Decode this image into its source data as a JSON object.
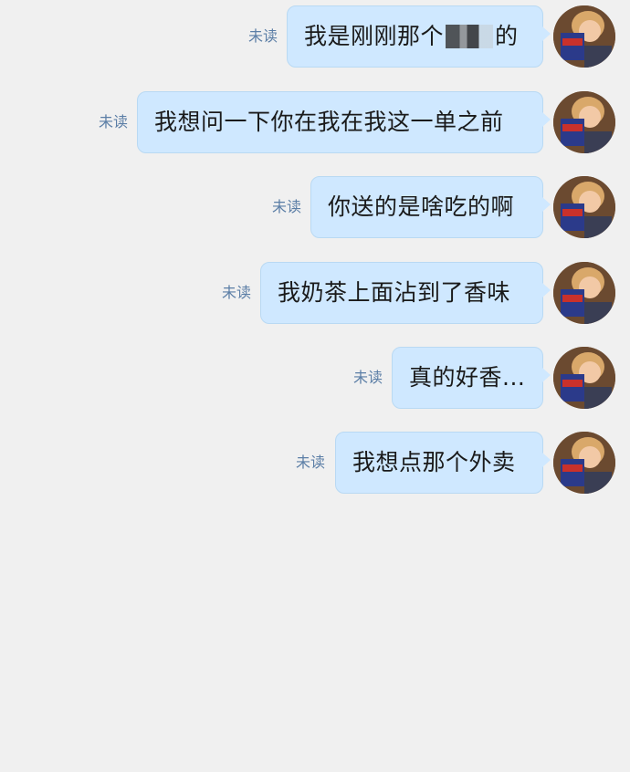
{
  "chat": {
    "messages": [
      {
        "text_before": "我是刚刚那个",
        "text_after": "的",
        "has_censor": true,
        "status": "未读"
      },
      {
        "text": "我想问一下你在我在我这一单之前",
        "status": "未读"
      },
      {
        "text": "你送的是啥吃的啊",
        "status": "未读"
      },
      {
        "text": "我奶茶上面沾到了香味",
        "status": "未读"
      },
      {
        "text": "真的好香...",
        "status": "未读"
      },
      {
        "text": "我想点那个外卖",
        "status": "未读"
      }
    ]
  },
  "colors": {
    "background": "#f0f0f0",
    "bubble": "#cfe8ff",
    "bubble_border": "#b9d9f3",
    "status_text": "#5b7ea6"
  },
  "icons": {
    "avatar": "avatar-photo-icon",
    "censor": "pixelated-censor-mosaic"
  }
}
